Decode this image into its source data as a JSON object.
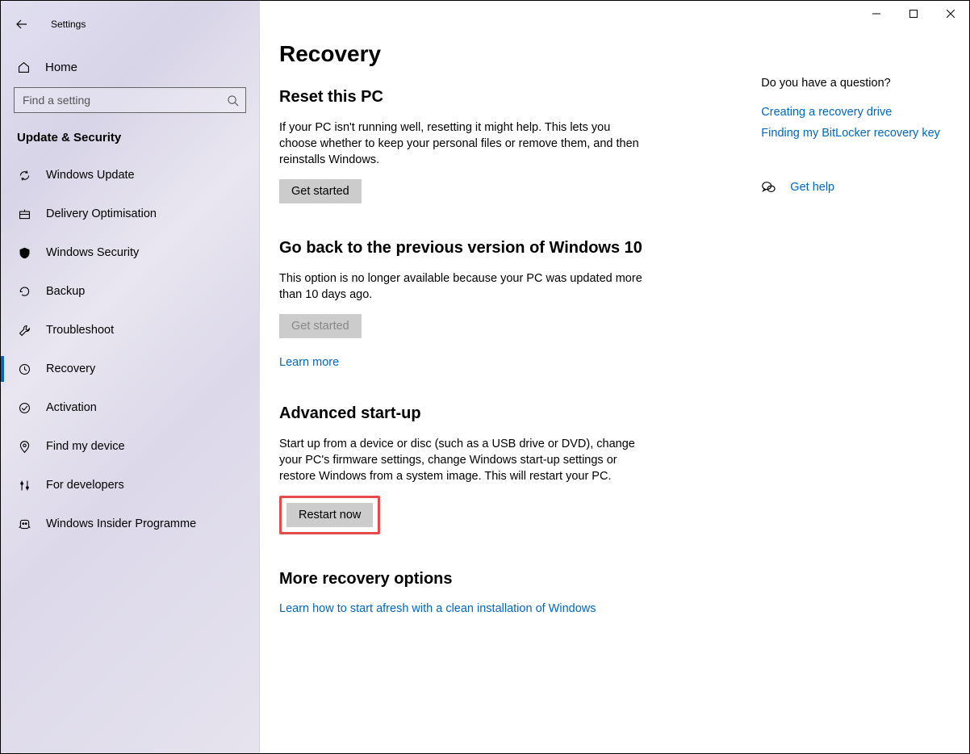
{
  "app_title": "Settings",
  "window_controls": {
    "min": "min",
    "max": "max",
    "close": "close"
  },
  "home_label": "Home",
  "search": {
    "placeholder": "Find a setting"
  },
  "category": "Update & Security",
  "nav": [
    {
      "id": "windows-update",
      "label": "Windows Update"
    },
    {
      "id": "delivery-optimisation",
      "label": "Delivery Optimisation"
    },
    {
      "id": "windows-security",
      "label": "Windows Security"
    },
    {
      "id": "backup",
      "label": "Backup"
    },
    {
      "id": "troubleshoot",
      "label": "Troubleshoot"
    },
    {
      "id": "recovery",
      "label": "Recovery"
    },
    {
      "id": "activation",
      "label": "Activation"
    },
    {
      "id": "find-my-device",
      "label": "Find my device"
    },
    {
      "id": "for-developers",
      "label": "For developers"
    },
    {
      "id": "windows-insider",
      "label": "Windows Insider Programme"
    }
  ],
  "page_title": "Recovery",
  "sections": {
    "reset": {
      "title": "Reset this PC",
      "body": "If your PC isn't running well, resetting it might help. This lets you choose whether to keep your personal files or remove them, and then reinstalls Windows.",
      "button": "Get started"
    },
    "goback": {
      "title": "Go back to the previous version of Windows 10",
      "body": "This option is no longer available because your PC was updated more than 10 days ago.",
      "button": "Get started",
      "learn_more": "Learn more"
    },
    "advanced": {
      "title": "Advanced start-up",
      "body": "Start up from a device or disc (such as a USB drive or DVD), change your PC's firmware settings, change Windows start-up settings or restore Windows from a system image. This will restart your PC.",
      "button": "Restart now"
    },
    "more": {
      "title": "More recovery options",
      "link": "Learn how to start afresh with a clean installation of Windows"
    }
  },
  "rightcol": {
    "question": "Do you have a question?",
    "links": [
      "Creating a recovery drive",
      "Finding my BitLocker recovery key"
    ],
    "get_help": "Get help"
  }
}
